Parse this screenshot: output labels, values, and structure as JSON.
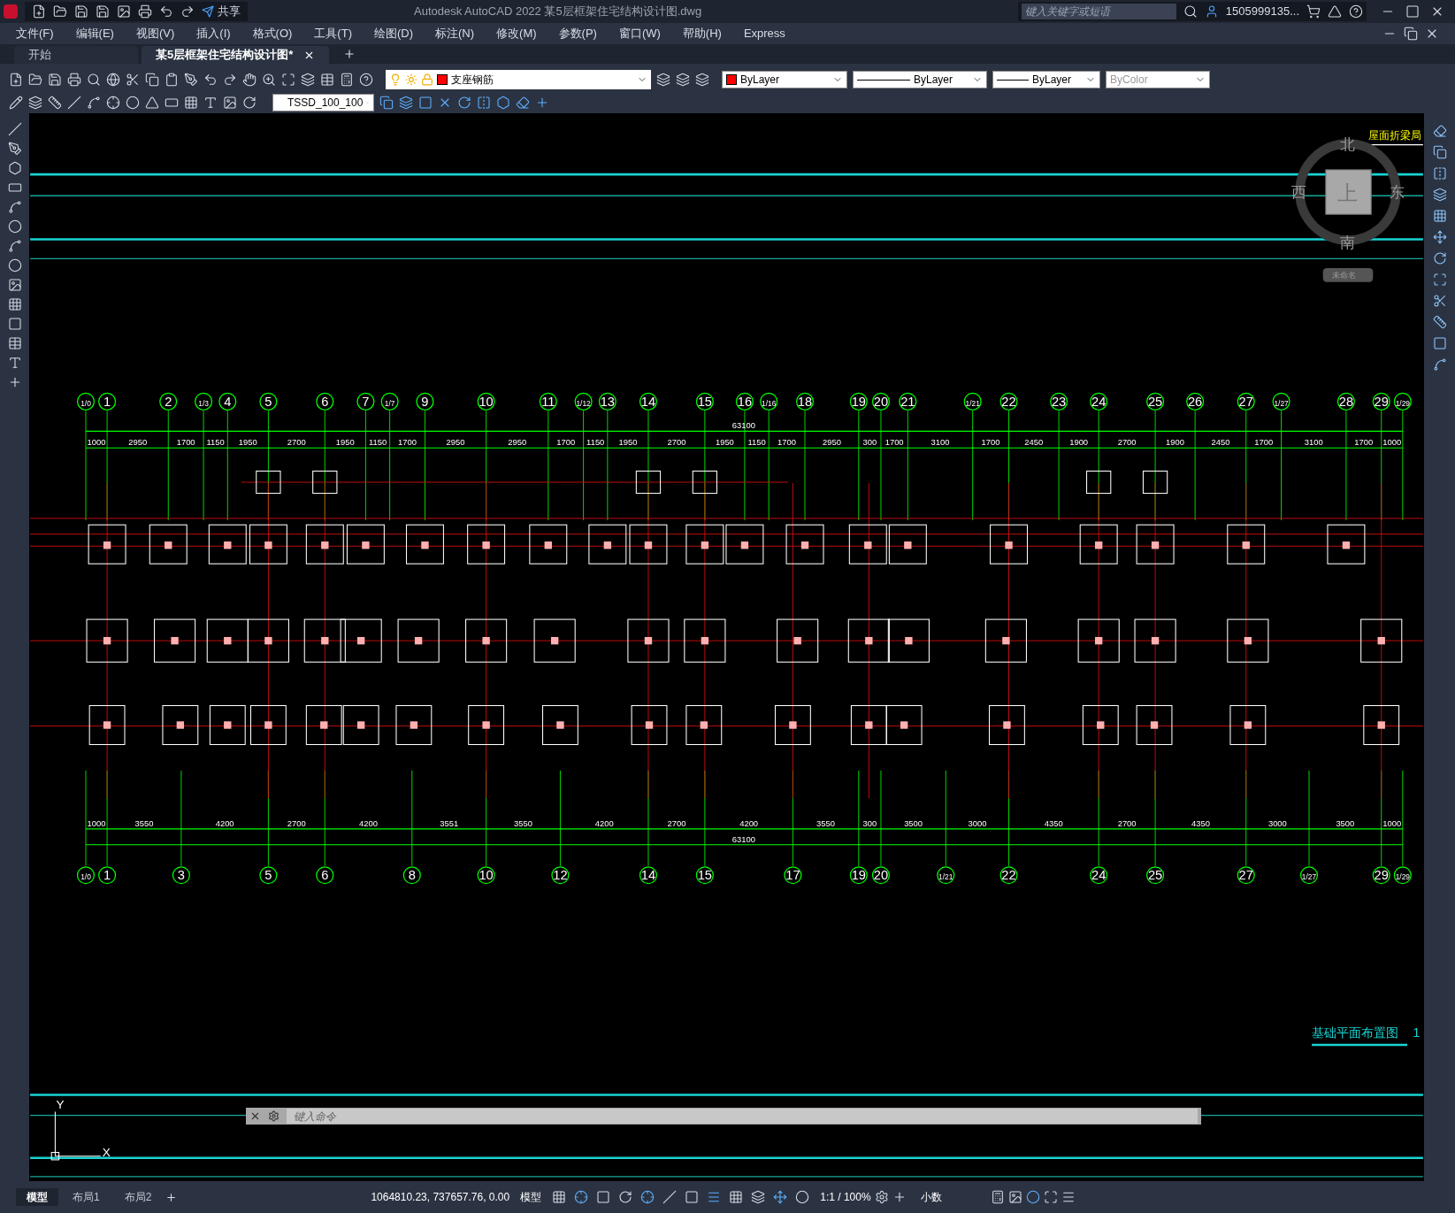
{
  "window": {
    "app_title": "Autodesk AutoCAD 2022",
    "file_title": "某5层框架住宅结构设计图.dwg",
    "share": "共享",
    "search": {
      "placeholder": "键入关键字或短语"
    },
    "user": "1505999135..."
  },
  "menu": [
    "文件(F)",
    "编辑(E)",
    "视图(V)",
    "插入(I)",
    "格式(O)",
    "工具(T)",
    "绘图(D)",
    "标注(N)",
    "修改(M)",
    "参数(P)",
    "窗口(W)",
    "帮助(H)",
    "Express"
  ],
  "file_tabs": [
    {
      "label": "开始",
      "selected": false
    },
    {
      "label": "某5层框架住宅结构设计图*",
      "selected": true
    }
  ],
  "properties": {
    "layer": "支座钢筋",
    "color_setting": "ByLayer",
    "linetype": "ByLayer",
    "lineweight": "ByLayer",
    "plot_style": "ByColor",
    "dim_style": "TSSD_100_100"
  },
  "drawing": {
    "top_axes": [
      "1/0",
      "1",
      "2",
      "1/3",
      "4",
      "5",
      "6",
      "7",
      "1/7",
      "9",
      "10",
      "11",
      "1/12",
      "13",
      "14",
      "15",
      "16",
      "1/16",
      "18",
      "19",
      "20",
      "21",
      "1/21",
      "22",
      "23",
      "24",
      "25",
      "26",
      "27",
      "1/27",
      "28",
      "29",
      "1/29"
    ],
    "top_dims": [
      "1000",
      "2950",
      "1700",
      "1150",
      "1950",
      "2700",
      "1950",
      "1150",
      "1700",
      "2950",
      "2950",
      "1700",
      "1150",
      "1950",
      "2700",
      "1950",
      "1150",
      "1700",
      "2950",
      "300",
      "1700",
      "3100",
      "1700",
      "2450",
      "1900",
      "2700",
      "1900",
      "2450",
      "1700",
      "3100",
      "1700",
      "1000"
    ],
    "top_total": "63100",
    "bottom_axes": [
      "1/0",
      "1",
      "3",
      "5",
      "6",
      "8",
      "10",
      "12",
      "14",
      "15",
      "17",
      "19",
      "20",
      "1/21",
      "22",
      "24",
      "25",
      "27",
      "1/27",
      "29",
      "1/29"
    ],
    "bottom_dims": [
      "1000",
      "3550",
      "4200",
      "2700",
      "4200",
      "3551",
      "3550",
      "4200",
      "2700",
      "4200",
      "3550",
      "300",
      "3500",
      "3000",
      "4350",
      "2700",
      "4350",
      "3000",
      "3500",
      "1000"
    ],
    "bottom_total": "63100",
    "corner_title": "屋面折梁局",
    "title": "基础平面布置图",
    "title_number": "1"
  },
  "viewcube": {
    "north": "北",
    "west": "西",
    "top": "上",
    "east": "东",
    "south": "南",
    "ucs": "未命名"
  },
  "ucs_icon": {
    "y": "Y",
    "x": "X"
  },
  "command": {
    "placeholder": "键入命令"
  },
  "layout_tabs": [
    {
      "label": "模型",
      "selected": true
    },
    {
      "label": "布局1",
      "selected": false
    },
    {
      "label": "布局2",
      "selected": false
    }
  ],
  "status_bar": {
    "coordinates": "1064810.23, 737657.76, 0.00",
    "space": "模型",
    "scale": "1:1 / 100%",
    "units": "小数"
  }
}
